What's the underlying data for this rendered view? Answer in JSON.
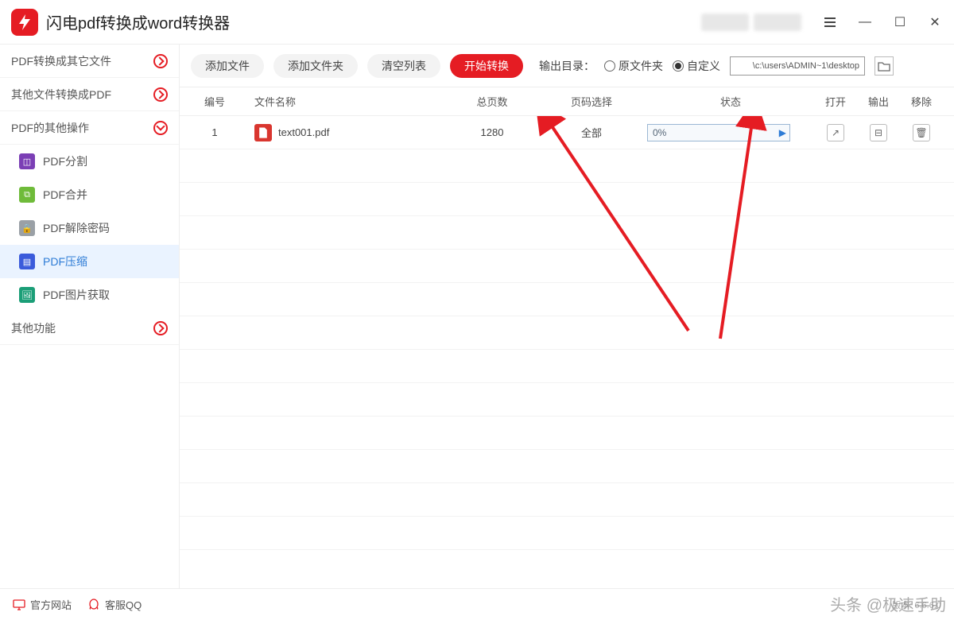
{
  "app": {
    "title": "闪电pdf转换成word转换器"
  },
  "window": {
    "menu_icon": "≡",
    "min_icon": "—",
    "max_icon": "☐",
    "close_icon": "✕"
  },
  "sidebar": {
    "groups": [
      {
        "label": "PDF转换成其它文件",
        "expanded": false
      },
      {
        "label": "其他文件转换成PDF",
        "expanded": false
      },
      {
        "label": "PDF的其他操作",
        "expanded": true
      },
      {
        "label": "其他功能",
        "expanded": false
      }
    ],
    "items": [
      {
        "label": "PDF分割",
        "icon_color": "ic-purple"
      },
      {
        "label": "PDF合并",
        "icon_color": "ic-green"
      },
      {
        "label": "PDF解除密码",
        "icon_color": "ic-gray"
      },
      {
        "label": "PDF压缩",
        "icon_color": "ic-blue",
        "active": true
      },
      {
        "label": "PDF图片获取",
        "icon_color": "ic-teal"
      }
    ]
  },
  "toolbar": {
    "add_file": "添加文件",
    "add_folder": "添加文件夹",
    "clear_list": "清空列表",
    "start": "开始转换",
    "output_label": "输出目录：",
    "radio_original": "原文件夹",
    "radio_custom": "自定义",
    "output_path": "c:\\users\\ADMIN~1\\desktop\\"
  },
  "table": {
    "headers": {
      "idx": "编号",
      "name": "文件名称",
      "pages": "总页数",
      "range": "页码选择",
      "status": "状态",
      "open": "打开",
      "output": "输出",
      "remove": "移除"
    },
    "rows": [
      {
        "idx": "1",
        "name": "text001.pdf",
        "pages": "1280",
        "range": "全部",
        "progress": "0%"
      }
    ]
  },
  "footer": {
    "site": "官方网站",
    "qq": "客服QQ",
    "version": "版本: 6.6.6.0"
  },
  "watermark": "头条 @极速手助"
}
